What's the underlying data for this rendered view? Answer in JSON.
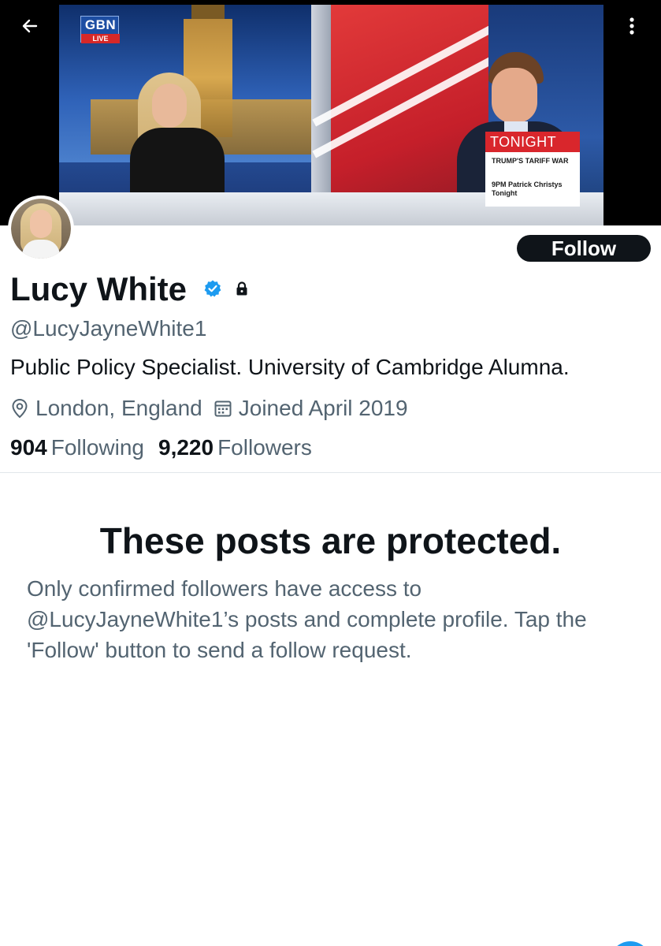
{
  "banner": {
    "channel_logo": "GBN",
    "live_label": "LIVE",
    "lower_third": {
      "heading": "TONIGHT",
      "line1": "TRUMP'S TARIFF WAR",
      "line2": "9PM Patrick Christys Tonight"
    }
  },
  "nav": {
    "back_icon": "arrow-left-icon",
    "more_icon": "more-vertical-icon"
  },
  "profile": {
    "name": "Lucy White",
    "handle": "@LucyJayneWhite1",
    "bio": "Public Policy Specialist. University of Cambridge Alumna.",
    "location": "London, England",
    "joined": "Joined April 2019",
    "following_count": "904",
    "following_label": "Following",
    "followers_count": "9,220",
    "followers_label": "Followers",
    "follow_button": "Follow",
    "verified_icon": "verified-badge-icon",
    "protected_icon": "lock-icon",
    "accent_color": "#1d9bf0"
  },
  "protected": {
    "title": "These posts are protected.",
    "message": "Only confirmed followers have access to @LucyJayneWhite1’s posts and complete profile. Tap the 'Follow' button to send a follow request."
  }
}
